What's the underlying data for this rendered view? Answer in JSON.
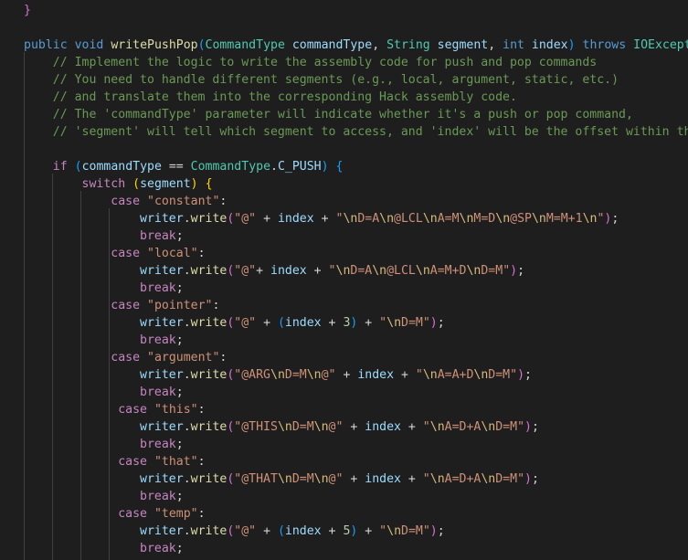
{
  "editor": {
    "colors": {
      "background": "#1e1e1e",
      "keyword": "#569cd6",
      "control": "#c586c0",
      "function": "#dcdcaa",
      "type": "#4ec9b0",
      "variable": "#9cdcfe",
      "number": "#b5cea8",
      "string": "#ce9178",
      "escape": "#d7ba7d",
      "comment": "#6a9955",
      "bracket_1": "#ffd700",
      "bracket_2": "#da70d6",
      "bracket_3": "#179fff"
    },
    "lines": [
      [
        {
          "t": "}",
          "c": "b2"
        }
      ],
      [],
      [
        {
          "t": "public",
          "c": "kw"
        },
        {
          "t": " "
        },
        {
          "t": "void",
          "c": "kw"
        },
        {
          "t": " "
        },
        {
          "t": "writePushPop",
          "c": "fn"
        },
        {
          "t": "(",
          "c": "b3"
        },
        {
          "t": "CommandType",
          "c": "type"
        },
        {
          "t": " "
        },
        {
          "t": "commandType",
          "c": "var"
        },
        {
          "t": ", "
        },
        {
          "t": "String",
          "c": "type"
        },
        {
          "t": " "
        },
        {
          "t": "segment",
          "c": "var"
        },
        {
          "t": ", "
        },
        {
          "t": "int",
          "c": "kw"
        },
        {
          "t": " "
        },
        {
          "t": "index",
          "c": "var"
        },
        {
          "t": ")",
          "c": "b3"
        },
        {
          "t": " "
        },
        {
          "t": "throws",
          "c": "kw"
        },
        {
          "t": " "
        },
        {
          "t": "IOException",
          "c": "type"
        }
      ],
      [
        {
          "t": "    "
        },
        {
          "t": "// Implement the logic to write the assembly code for push and pop commands",
          "c": "com"
        }
      ],
      [
        {
          "t": "    "
        },
        {
          "t": "// You need to handle different segments (e.g., local, argument, static, etc.)",
          "c": "com"
        }
      ],
      [
        {
          "t": "    "
        },
        {
          "t": "// and translate them into the corresponding Hack assembly code.",
          "c": "com"
        }
      ],
      [
        {
          "t": "    "
        },
        {
          "t": "// The 'commandType' parameter will indicate whether it's a push or pop command,",
          "c": "com"
        }
      ],
      [
        {
          "t": "    "
        },
        {
          "t": "// 'segment' will tell which segment to access, and 'index' will be the offset within that segment.",
          "c": "com"
        }
      ],
      [],
      [
        {
          "t": "    "
        },
        {
          "t": "if",
          "c": "ctl"
        },
        {
          "t": " "
        },
        {
          "t": "(",
          "c": "b3"
        },
        {
          "t": "commandType",
          "c": "var"
        },
        {
          "t": " == "
        },
        {
          "t": "CommandType",
          "c": "type"
        },
        {
          "t": "."
        },
        {
          "t": "C_PUSH",
          "c": "var"
        },
        {
          "t": ")",
          "c": "b3"
        },
        {
          "t": " "
        },
        {
          "t": "{",
          "c": "b3"
        }
      ],
      [
        {
          "t": "        "
        },
        {
          "t": "switch",
          "c": "ctl"
        },
        {
          "t": " "
        },
        {
          "t": "(",
          "c": "b1"
        },
        {
          "t": "segment",
          "c": "var"
        },
        {
          "t": ")",
          "c": "b1"
        },
        {
          "t": " "
        },
        {
          "t": "{",
          "c": "b1"
        }
      ],
      [
        {
          "t": "            "
        },
        {
          "t": "case",
          "c": "ctl"
        },
        {
          "t": " "
        },
        {
          "t": "\"constant\"",
          "c": "str"
        },
        {
          "t": ":"
        }
      ],
      [
        {
          "t": "                "
        },
        {
          "t": "writer",
          "c": "var"
        },
        {
          "t": "."
        },
        {
          "t": "write",
          "c": "fn"
        },
        {
          "t": "(",
          "c": "b2"
        },
        {
          "t": "\"@\"",
          "c": "str"
        },
        {
          "t": " + "
        },
        {
          "t": "index",
          "c": "var"
        },
        {
          "t": " + "
        },
        {
          "t": "\"",
          "c": "str"
        },
        {
          "t": "\\n",
          "c": "esc"
        },
        {
          "t": "D=A",
          "c": "str"
        },
        {
          "t": "\\n",
          "c": "esc"
        },
        {
          "t": "@LCL",
          "c": "str"
        },
        {
          "t": "\\n",
          "c": "esc"
        },
        {
          "t": "A=M",
          "c": "str"
        },
        {
          "t": "\\n",
          "c": "esc"
        },
        {
          "t": "M=D",
          "c": "str"
        },
        {
          "t": "\\n",
          "c": "esc"
        },
        {
          "t": "@SP",
          "c": "str"
        },
        {
          "t": "\\n",
          "c": "esc"
        },
        {
          "t": "M=M+1",
          "c": "str"
        },
        {
          "t": "\\n",
          "c": "esc"
        },
        {
          "t": "\"",
          "c": "str"
        },
        {
          "t": ")",
          "c": "b2"
        },
        {
          "t": ";"
        }
      ],
      [
        {
          "t": "                "
        },
        {
          "t": "break",
          "c": "ctl"
        },
        {
          "t": ";"
        }
      ],
      [
        {
          "t": "            "
        },
        {
          "t": "case",
          "c": "ctl"
        },
        {
          "t": " "
        },
        {
          "t": "\"local\"",
          "c": "str"
        },
        {
          "t": ":"
        }
      ],
      [
        {
          "t": "                "
        },
        {
          "t": "writer",
          "c": "var"
        },
        {
          "t": "."
        },
        {
          "t": "write",
          "c": "fn"
        },
        {
          "t": "(",
          "c": "b2"
        },
        {
          "t": "\"@\"",
          "c": "str"
        },
        {
          "t": "+ "
        },
        {
          "t": "index",
          "c": "var"
        },
        {
          "t": " + "
        },
        {
          "t": "\"",
          "c": "str"
        },
        {
          "t": "\\n",
          "c": "esc"
        },
        {
          "t": "D=A",
          "c": "str"
        },
        {
          "t": "\\n",
          "c": "esc"
        },
        {
          "t": "@LCL",
          "c": "str"
        },
        {
          "t": "\\n",
          "c": "esc"
        },
        {
          "t": "A=M+D",
          "c": "str"
        },
        {
          "t": "\\n",
          "c": "esc"
        },
        {
          "t": "D=M",
          "c": "str"
        },
        {
          "t": "\"",
          "c": "str"
        },
        {
          "t": ")",
          "c": "b2"
        },
        {
          "t": ";"
        }
      ],
      [
        {
          "t": "                "
        },
        {
          "t": "break",
          "c": "ctl"
        },
        {
          "t": ";"
        }
      ],
      [
        {
          "t": "            "
        },
        {
          "t": "case",
          "c": "ctl"
        },
        {
          "t": " "
        },
        {
          "t": "\"pointer\"",
          "c": "str"
        },
        {
          "t": ":"
        }
      ],
      [
        {
          "t": "                "
        },
        {
          "t": "writer",
          "c": "var"
        },
        {
          "t": "."
        },
        {
          "t": "write",
          "c": "fn"
        },
        {
          "t": "(",
          "c": "b2"
        },
        {
          "t": "\"@\"",
          "c": "str"
        },
        {
          "t": " + "
        },
        {
          "t": "(",
          "c": "b3"
        },
        {
          "t": "index",
          "c": "var"
        },
        {
          "t": " + "
        },
        {
          "t": "3",
          "c": "num"
        },
        {
          "t": ")",
          "c": "b3"
        },
        {
          "t": " + "
        },
        {
          "t": "\"",
          "c": "str"
        },
        {
          "t": "\\n",
          "c": "esc"
        },
        {
          "t": "D=M",
          "c": "str"
        },
        {
          "t": "\"",
          "c": "str"
        },
        {
          "t": ")",
          "c": "b2"
        },
        {
          "t": ";"
        }
      ],
      [
        {
          "t": "                "
        },
        {
          "t": "break",
          "c": "ctl"
        },
        {
          "t": ";"
        }
      ],
      [
        {
          "t": "            "
        },
        {
          "t": "case",
          "c": "ctl"
        },
        {
          "t": " "
        },
        {
          "t": "\"argument\"",
          "c": "str"
        },
        {
          "t": ":"
        }
      ],
      [
        {
          "t": "                "
        },
        {
          "t": "writer",
          "c": "var"
        },
        {
          "t": "."
        },
        {
          "t": "write",
          "c": "fn"
        },
        {
          "t": "(",
          "c": "b2"
        },
        {
          "t": "\"@ARG",
          "c": "str"
        },
        {
          "t": "\\n",
          "c": "esc"
        },
        {
          "t": "D=M",
          "c": "str"
        },
        {
          "t": "\\n",
          "c": "esc"
        },
        {
          "t": "@\"",
          "c": "str"
        },
        {
          "t": " + "
        },
        {
          "t": "index",
          "c": "var"
        },
        {
          "t": " + "
        },
        {
          "t": "\"",
          "c": "str"
        },
        {
          "t": "\\n",
          "c": "esc"
        },
        {
          "t": "A=A+D",
          "c": "str"
        },
        {
          "t": "\\n",
          "c": "esc"
        },
        {
          "t": "D=M",
          "c": "str"
        },
        {
          "t": "\"",
          "c": "str"
        },
        {
          "t": ")",
          "c": "b2"
        },
        {
          "t": ";"
        }
      ],
      [
        {
          "t": "                "
        },
        {
          "t": "break",
          "c": "ctl"
        },
        {
          "t": ";"
        }
      ],
      [
        {
          "t": "             "
        },
        {
          "t": "case",
          "c": "ctl"
        },
        {
          "t": " "
        },
        {
          "t": "\"this\"",
          "c": "str"
        },
        {
          "t": ":"
        }
      ],
      [
        {
          "t": "                "
        },
        {
          "t": "writer",
          "c": "var"
        },
        {
          "t": "."
        },
        {
          "t": "write",
          "c": "fn"
        },
        {
          "t": "(",
          "c": "b2"
        },
        {
          "t": "\"@THIS",
          "c": "str"
        },
        {
          "t": "\\n",
          "c": "esc"
        },
        {
          "t": "D=M",
          "c": "str"
        },
        {
          "t": "\\n",
          "c": "esc"
        },
        {
          "t": "@\"",
          "c": "str"
        },
        {
          "t": " + "
        },
        {
          "t": "index",
          "c": "var"
        },
        {
          "t": " + "
        },
        {
          "t": "\"",
          "c": "str"
        },
        {
          "t": "\\n",
          "c": "esc"
        },
        {
          "t": "A=D+A",
          "c": "str"
        },
        {
          "t": "\\n",
          "c": "esc"
        },
        {
          "t": "D=M",
          "c": "str"
        },
        {
          "t": "\"",
          "c": "str"
        },
        {
          "t": ")",
          "c": "b2"
        },
        {
          "t": ";"
        }
      ],
      [
        {
          "t": "                "
        },
        {
          "t": "break",
          "c": "ctl"
        },
        {
          "t": ";"
        }
      ],
      [
        {
          "t": "             "
        },
        {
          "t": "case",
          "c": "ctl"
        },
        {
          "t": " "
        },
        {
          "t": "\"that\"",
          "c": "str"
        },
        {
          "t": ":"
        }
      ],
      [
        {
          "t": "                "
        },
        {
          "t": "writer",
          "c": "var"
        },
        {
          "t": "."
        },
        {
          "t": "write",
          "c": "fn"
        },
        {
          "t": "(",
          "c": "b2"
        },
        {
          "t": "\"@THAT",
          "c": "str"
        },
        {
          "t": "\\n",
          "c": "esc"
        },
        {
          "t": "D=M",
          "c": "str"
        },
        {
          "t": "\\n",
          "c": "esc"
        },
        {
          "t": "@\"",
          "c": "str"
        },
        {
          "t": " + "
        },
        {
          "t": "index",
          "c": "var"
        },
        {
          "t": " + "
        },
        {
          "t": "\"",
          "c": "str"
        },
        {
          "t": "\\n",
          "c": "esc"
        },
        {
          "t": "A=D+A",
          "c": "str"
        },
        {
          "t": "\\n",
          "c": "esc"
        },
        {
          "t": "D=M",
          "c": "str"
        },
        {
          "t": "\"",
          "c": "str"
        },
        {
          "t": ")",
          "c": "b2"
        },
        {
          "t": ";"
        }
      ],
      [
        {
          "t": "                "
        },
        {
          "t": "break",
          "c": "ctl"
        },
        {
          "t": ";"
        }
      ],
      [
        {
          "t": "             "
        },
        {
          "t": "case",
          "c": "ctl"
        },
        {
          "t": " "
        },
        {
          "t": "\"temp\"",
          "c": "str"
        },
        {
          "t": ":"
        }
      ],
      [
        {
          "t": "                "
        },
        {
          "t": "writer",
          "c": "var"
        },
        {
          "t": "."
        },
        {
          "t": "write",
          "c": "fn"
        },
        {
          "t": "(",
          "c": "b2"
        },
        {
          "t": "\"@\"",
          "c": "str"
        },
        {
          "t": " + "
        },
        {
          "t": "(",
          "c": "b3"
        },
        {
          "t": "index",
          "c": "var"
        },
        {
          "t": " + "
        },
        {
          "t": "5",
          "c": "num"
        },
        {
          "t": ")",
          "c": "b3"
        },
        {
          "t": " + "
        },
        {
          "t": "\"",
          "c": "str"
        },
        {
          "t": "\\n",
          "c": "esc"
        },
        {
          "t": "D=M",
          "c": "str"
        },
        {
          "t": "\"",
          "c": "str"
        },
        {
          "t": ")",
          "c": "b2"
        },
        {
          "t": ";"
        }
      ],
      [
        {
          "t": "                "
        },
        {
          "t": "break",
          "c": "ctl"
        },
        {
          "t": ";"
        }
      ]
    ]
  }
}
